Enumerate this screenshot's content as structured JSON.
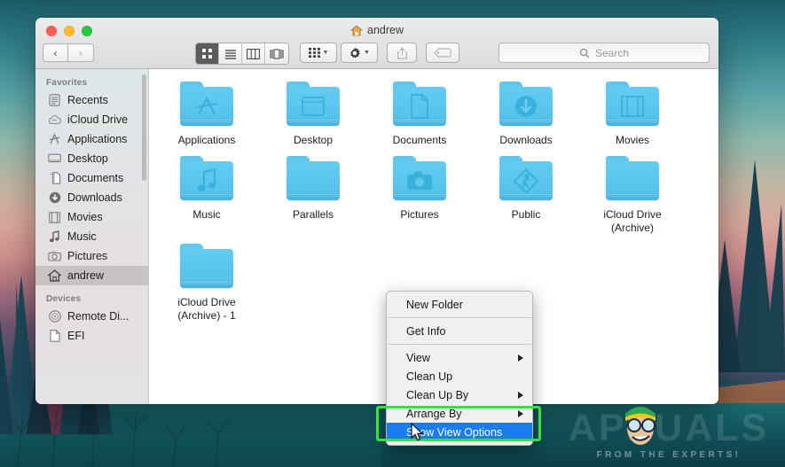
{
  "window": {
    "title": "andrew",
    "title_icon": "home-icon",
    "traffic_lights": [
      {
        "name": "close",
        "color": "#ff5f57"
      },
      {
        "name": "minimize",
        "color": "#febc2e"
      },
      {
        "name": "zoom",
        "color": "#28c840"
      }
    ]
  },
  "toolbar": {
    "back_label": "‹",
    "forward_label": "›",
    "view_modes": [
      {
        "name": "icon-view",
        "icon": "grid-icon",
        "active": true
      },
      {
        "name": "list-view",
        "icon": "list-icon",
        "active": false
      },
      {
        "name": "column-view",
        "icon": "columns-icon",
        "active": false
      },
      {
        "name": "gallery-view",
        "icon": "gallery-icon",
        "active": false
      }
    ],
    "arrange_icon": "arrange-grid-icon",
    "action_icon": "gear-icon",
    "share_icon": "share-icon",
    "tags_icon": "tag-icon"
  },
  "search": {
    "placeholder": "Search",
    "value": "",
    "icon": "search-icon"
  },
  "sidebar": {
    "sections": [
      {
        "header": "Favorites",
        "items": [
          {
            "label": "Recents",
            "icon": "clock-document-icon",
            "selected": false
          },
          {
            "label": "iCloud Drive",
            "icon": "icloud-icon",
            "selected": false
          },
          {
            "label": "Applications",
            "icon": "applications-icon",
            "selected": false
          },
          {
            "label": "Desktop",
            "icon": "desktop-icon",
            "selected": false
          },
          {
            "label": "Documents",
            "icon": "documents-icon",
            "selected": false
          },
          {
            "label": "Downloads",
            "icon": "downloads-icon",
            "selected": false
          },
          {
            "label": "Movies",
            "icon": "film-icon",
            "selected": false
          },
          {
            "label": "Music",
            "icon": "music-note-icon",
            "selected": false
          },
          {
            "label": "Pictures",
            "icon": "camera-icon",
            "selected": false
          },
          {
            "label": "andrew",
            "icon": "home-icon",
            "selected": true
          }
        ]
      },
      {
        "header": "Devices",
        "items": [
          {
            "label": "Remote Di...",
            "icon": "disc-icon",
            "selected": false
          },
          {
            "label": "EFI",
            "icon": "drive-icon",
            "selected": false
          }
        ]
      }
    ]
  },
  "files": {
    "rows": [
      [
        {
          "label": "Applications",
          "glyph": "applications-glyph"
        },
        {
          "label": "Desktop",
          "glyph": "desktop-glyph"
        },
        {
          "label": "Documents",
          "glyph": "document-glyph"
        },
        {
          "label": "Downloads",
          "glyph": "download-glyph"
        },
        {
          "label": "Movies",
          "glyph": "film-glyph"
        }
      ],
      [
        {
          "label": "Music",
          "glyph": "music-glyph"
        },
        {
          "label": "Parallels",
          "glyph": "none"
        },
        {
          "label": "Pictures",
          "glyph": "camera-glyph"
        },
        {
          "label": "Public",
          "glyph": "public-glyph"
        },
        {
          "label": "iCloud Drive\n(Archive)",
          "glyph": "none"
        }
      ],
      [
        {
          "label": "iCloud Drive\n(Archive) - 1",
          "glyph": "none"
        }
      ]
    ]
  },
  "context_menu": {
    "items": [
      {
        "label": "New Folder",
        "submenu": false,
        "highlighted": false
      },
      {
        "separator": true
      },
      {
        "label": "Get Info",
        "submenu": false,
        "highlighted": false
      },
      {
        "separator": true
      },
      {
        "label": "View",
        "submenu": true,
        "highlighted": false
      },
      {
        "label": "Clean Up",
        "submenu": false,
        "highlighted": false
      },
      {
        "label": "Clean Up By",
        "submenu": true,
        "highlighted": false
      },
      {
        "label": "Arrange By",
        "submenu": true,
        "highlighted": false
      },
      {
        "label": "Show View Options",
        "submenu": false,
        "highlighted": true
      }
    ]
  },
  "annotation": {
    "color": "#39e03a",
    "target": "Show View Options"
  },
  "watermark": {
    "brand": "APPUALS",
    "tagline": "FROM THE EXPERTS!"
  }
}
